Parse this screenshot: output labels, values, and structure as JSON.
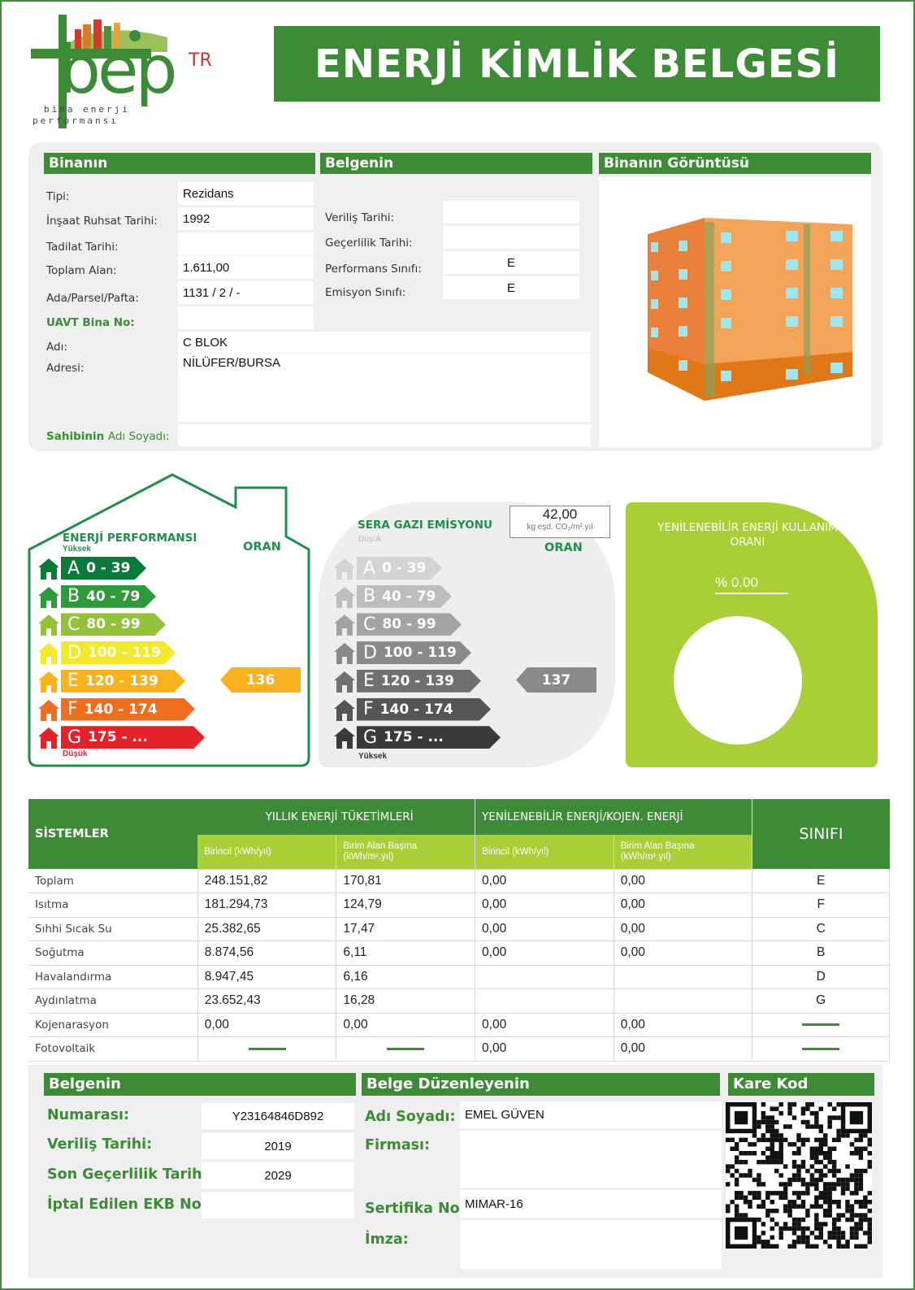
{
  "logo": {
    "mark": "bep",
    "suffix": "TR",
    "subtitle_1": "bina enerji",
    "subtitle_2": "performansı"
  },
  "title": "ENERJİ KİMLİK BELGESİ",
  "building": {
    "header": "Binanın",
    "tipi_label": "Tipi:",
    "tipi": "Rezidans",
    "ruhsat_label": "İnşaat Ruhsat Tarihi:",
    "ruhsat": "1992",
    "tadilat_label": "Tadilat Tarihi:",
    "tadilat": "",
    "alan_label": "Toplam Alan:",
    "alan": "1.611,00",
    "ada_label": "Ada/Parsel/Pafta:",
    "ada": "1131 / 2 / -",
    "uavt_label": "UAVT Bina No:",
    "uavt": "",
    "adi_label": "Adı:",
    "adi": "C BLOK",
    "adres_label": "Adresi:",
    "adres": "NİLÜFER/BURSA",
    "sahibi_label_1": "Sahibinin",
    "sahibi_label_2": "Adı Soyadı:",
    "sahibi": ""
  },
  "certificate": {
    "header": "Belgenin",
    "verilis_label": "Veriliş Tarihi:",
    "verilis": "",
    "gecerlilik_label": "Geçerlilik Tarihi:",
    "gecerlilik": "",
    "perf_label": "Performans Sınıfı:",
    "perf": "E",
    "emisyon_label": "Emisyon Sınıfı:",
    "emisyon": "E"
  },
  "image_panel": {
    "header": "Binanın Görüntüsü"
  },
  "energy": {
    "title": "ENERJİ PERFORMANSI",
    "top": "Yüksek",
    "bottom": "Düşük",
    "oran": "ORAN",
    "value": "136",
    "bands": [
      {
        "letter": "A",
        "range": "0 - 39",
        "color": "#0a7a3a"
      },
      {
        "letter": "B",
        "range": "40 - 79",
        "color": "#2f9a3b"
      },
      {
        "letter": "C",
        "range": "80 - 99",
        "color": "#93c13a"
      },
      {
        "letter": "D",
        "range": "100 - 119",
        "color": "#f3e82b"
      },
      {
        "letter": "E",
        "range": "120 - 139",
        "color": "#f7b21e"
      },
      {
        "letter": "F",
        "range": "140 - 174",
        "color": "#ef6f1f"
      },
      {
        "letter": "G",
        "range": "175 - ...",
        "color": "#e3222a"
      }
    ],
    "active_index": 4,
    "active_color": "#f7b21e"
  },
  "emission": {
    "title": "SERA GAZI EMİSYONU",
    "top": "Düşük",
    "bottom": "Yüksek",
    "oran": "ORAN",
    "box_value": "42,00",
    "box_unit": "kg eşd. CO₂/m².yıl",
    "value": "137",
    "bands": [
      {
        "letter": "A",
        "range": "0 - 39",
        "color": "#d4d4d4"
      },
      {
        "letter": "B",
        "range": "40 - 79",
        "color": "#bdbdbd"
      },
      {
        "letter": "C",
        "range": "80 - 99",
        "color": "#a3a3a3"
      },
      {
        "letter": "D",
        "range": "100 - 119",
        "color": "#8a8a8a"
      },
      {
        "letter": "E",
        "range": "120 - 139",
        "color": "#707070"
      },
      {
        "letter": "F",
        "range": "140 - 174",
        "color": "#555555"
      },
      {
        "letter": "G",
        "range": "175 - ...",
        "color": "#3a3a3a"
      }
    ],
    "active_index": 4,
    "active_color": "#8a8a8a"
  },
  "renewable": {
    "title_1": "YENİLENEBİLİR ENERJİ KULLANIM",
    "title_2": "ORANI",
    "value": "% 0.00"
  },
  "systems": {
    "h_systems": "SİSTEMLER",
    "h_annual": "YILLIK ENERJİ TÜKETİMLERİ",
    "h_renew": "YENİLENEBİLİR ENERJİ/KOJEN. ENERJİ",
    "h_class": "SINIFI",
    "h_primary": "Birincil (kWh/yıl)",
    "h_area_1": "Birim Alan Başına",
    "h_area_2": "(kWh/m².yıl)",
    "rows": [
      {
        "name": "Toplam",
        "c1": "248.151,82",
        "c2": "170,81",
        "c3": "0,00",
        "c4": "0,00",
        "cls": "E"
      },
      {
        "name": "Isıtma",
        "c1": "181.294,73",
        "c2": "124,79",
        "c3": "0,00",
        "c4": "0,00",
        "cls": "F"
      },
      {
        "name": "Sıhhi Sıcak Su",
        "c1": "25.382,65",
        "c2": "17,47",
        "c3": "0,00",
        "c4": "0,00",
        "cls": "C"
      },
      {
        "name": "Soğutma",
        "c1": "8.874,56",
        "c2": "6,11",
        "c3": "0,00",
        "c4": "0,00",
        "cls": "B"
      },
      {
        "name": "Havalandırma",
        "c1": "8.947,45",
        "c2": "6,16",
        "c3": "",
        "c4": "",
        "cls": "D"
      },
      {
        "name": "Aydınlatma",
        "c1": "23.652,43",
        "c2": "16,28",
        "c3": "",
        "c4": "",
        "cls": "G"
      },
      {
        "name": "Kojenarasyon",
        "c1": "0,00",
        "c2": "0,00",
        "c3": "0,00",
        "c4": "0,00",
        "cls": "—"
      },
      {
        "name": "Fotovoltaik",
        "c1": "—",
        "c2": "—",
        "c3": "0,00",
        "c4": "0,00",
        "cls": "—"
      }
    ]
  },
  "footer": {
    "cert_header": "Belgenin",
    "numara_label": "Numarası:",
    "numara": "Y23164846D892",
    "verilis_label": "Veriliş Tarihi:",
    "verilis": "2019",
    "son_label": "Son Geçerlilik Tarihi:",
    "son": "2029",
    "iptal_label": "İptal Edilen EKB No:",
    "iptal": "",
    "issuer_header": "Belge Düzenleyenin",
    "adsoyad_label": "Adı Soyadı:",
    "adsoyad": "EMEL GÜVEN",
    "firma_label": "Firması:",
    "firma": "",
    "sertifika_label": "Sertifika No:",
    "sertifika": "MIMAR-16",
    "imza_label": "İmza:",
    "qr_header": "Kare Kod"
  }
}
